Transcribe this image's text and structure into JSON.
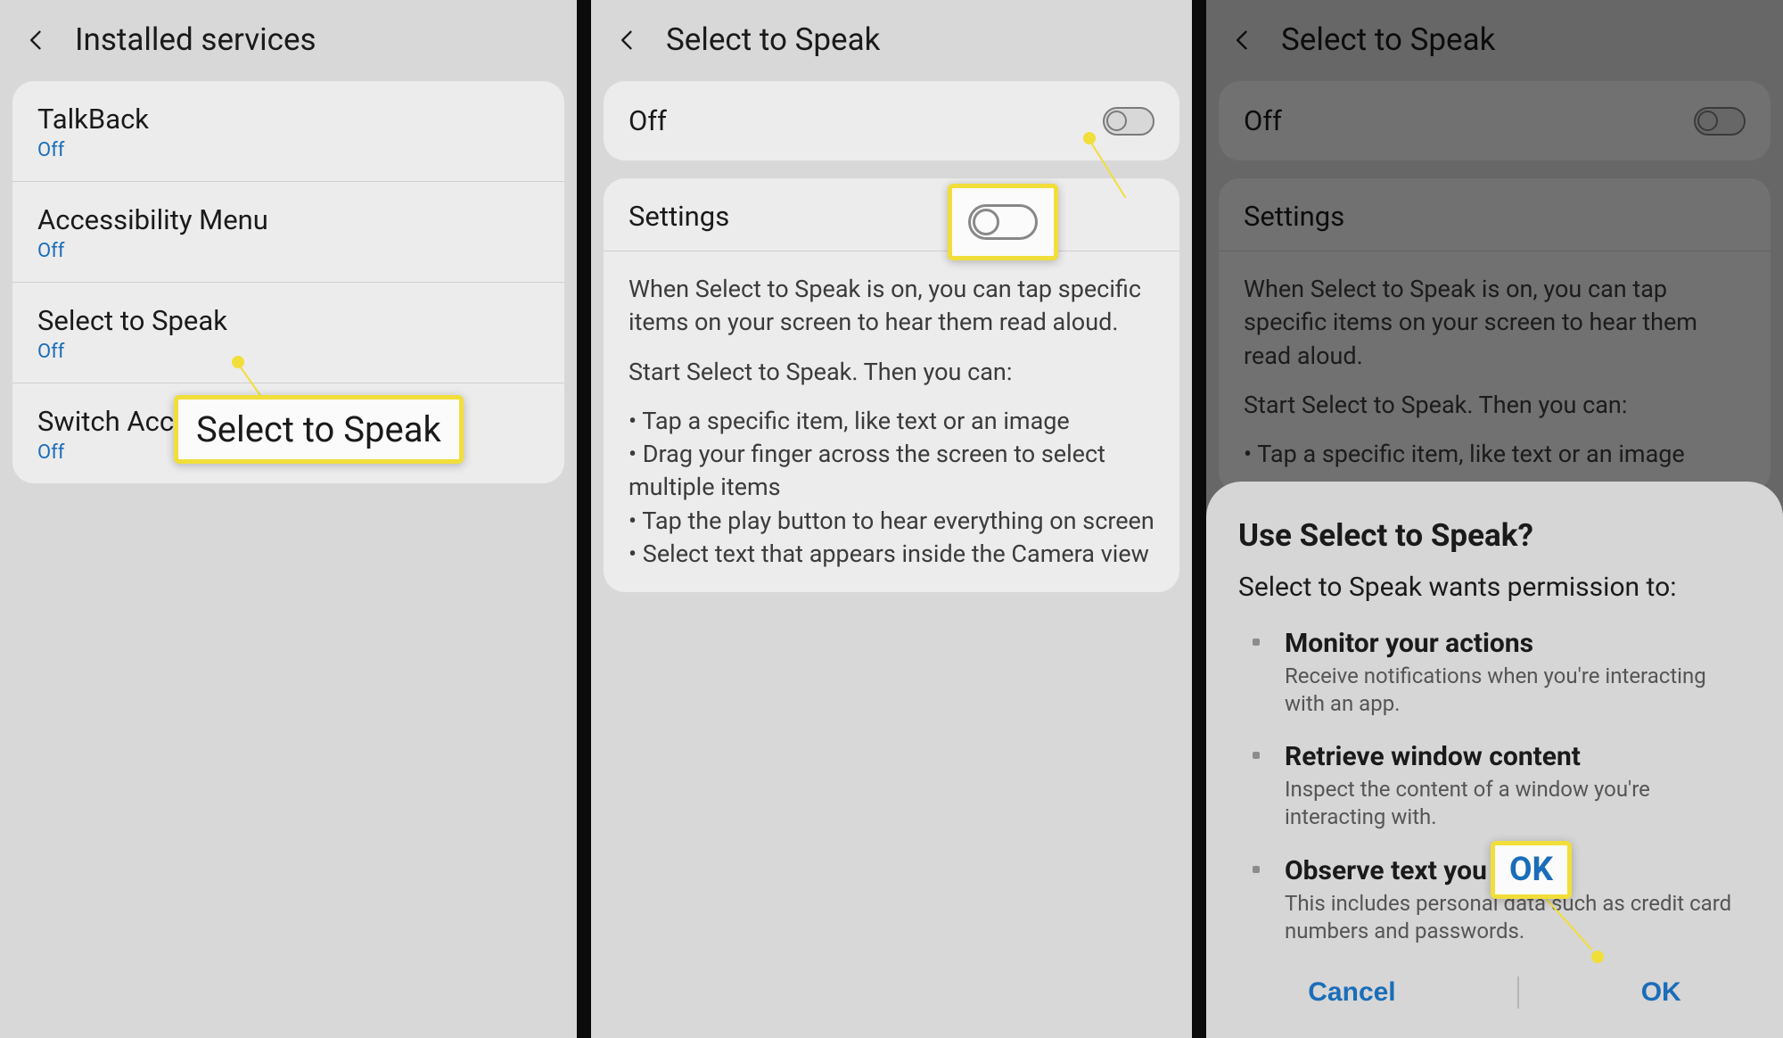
{
  "phone1": {
    "header": "Installed services",
    "services": [
      {
        "title": "TalkBack",
        "status": "Off"
      },
      {
        "title": "Accessibility Menu",
        "status": "Off"
      },
      {
        "title": "Select to Speak",
        "status": "Off"
      },
      {
        "title": "Switch Access",
        "status": "Off"
      }
    ],
    "callout": "Select to Speak"
  },
  "phone2": {
    "header": "Select to Speak",
    "toggle_label": "Off",
    "settings_label": "Settings",
    "info_para1": "When Select to Speak is on, you can tap specific items on your screen to hear them read aloud.",
    "info_para2": "Start Select to Speak. Then you can:",
    "info_bullets": "• Tap a specific item, like text or an image\n• Drag your finger across the screen to select multiple items\n• Tap the play button to hear everything on screen\n• Select text that appears inside the Camera view"
  },
  "phone3": {
    "header": "Select to Speak",
    "toggle_label": "Off",
    "settings_label": "Settings",
    "info_para1": "When Select to Speak is on, you can tap specific items on your screen to hear them read aloud.",
    "info_para2": "Start Select to Speak. Then you can:",
    "info_bullet1": "• Tap a specific item, like text or an image",
    "dialog": {
      "title": "Use Select to Speak?",
      "subtitle": "Select to Speak wants permission to:",
      "perms": [
        {
          "title": "Monitor your actions",
          "desc": "Receive notifications when you're interacting with an app."
        },
        {
          "title": "Retrieve window content",
          "desc": "Inspect the content of a window you're interacting with."
        },
        {
          "title": "Observe text you type",
          "desc": "This includes personal data such as credit card numbers and passwords."
        }
      ],
      "cancel": "Cancel",
      "ok": "OK"
    },
    "callout_ok": "OK"
  }
}
